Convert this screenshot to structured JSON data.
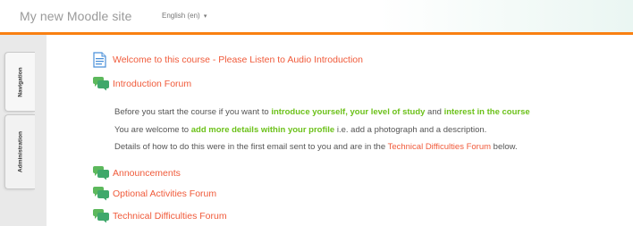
{
  "header": {
    "site_title": "My new Moodle site",
    "language": "English (en)",
    "language_caret": "▾"
  },
  "sidebar": {
    "tabs": [
      {
        "label": "Navigation"
      },
      {
        "label": "Administration"
      }
    ]
  },
  "course": {
    "items": [
      {
        "label": "Welcome to this course - Please Listen to Audio Introduction",
        "icon": "page-icon"
      },
      {
        "label": "Introduction Forum",
        "icon": "forum-icon"
      },
      {
        "label": "Announcements",
        "icon": "forum-icon"
      },
      {
        "label": "Optional Activities Forum",
        "icon": "forum-icon"
      },
      {
        "label": "Technical Difficulties Forum",
        "icon": "forum-icon"
      }
    ],
    "description": {
      "line1": {
        "t1": "Before you start the course if you want to ",
        "h1": "introduce yourself, your level of study",
        "t2": " and ",
        "h2": "interest in the course"
      },
      "line2": {
        "t1": "You are welcome to ",
        "h1": "add more details within your profile",
        "t2": " i.e. add a photograph and a description."
      },
      "line3": {
        "t1": "Details of how to do this were in the first email sent to you and are in the ",
        "link": "Technical Difficulties Forum",
        "t2": " below."
      }
    }
  },
  "colors": {
    "accent": "#f98012",
    "link": "#f05a3a",
    "highlight": "#6cc11a",
    "forum_icon": "#3fa86b",
    "page_icon": "#4a90d9"
  }
}
